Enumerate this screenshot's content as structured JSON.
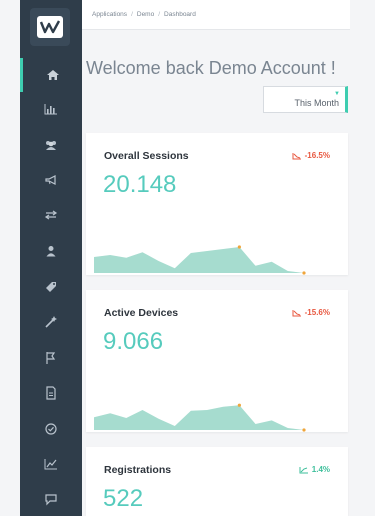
{
  "breadcrumb": [
    "Applications",
    "Demo",
    "Dashboard"
  ],
  "welcome": "Welcome back Demo Account !",
  "period_select": {
    "value": "This Month"
  },
  "sidebar": {
    "items": [
      {
        "icon": "home-icon",
        "active": true
      },
      {
        "icon": "bar-chart-icon"
      },
      {
        "icon": "users-icon"
      },
      {
        "icon": "megaphone-icon"
      },
      {
        "icon": "exchange-icon"
      },
      {
        "icon": "user-icon"
      },
      {
        "icon": "tag-icon"
      },
      {
        "icon": "magic-wand-icon"
      },
      {
        "icon": "flag-icon"
      },
      {
        "icon": "document-icon"
      },
      {
        "icon": "check-circle-icon"
      },
      {
        "icon": "line-chart-icon"
      },
      {
        "icon": "chat-icon"
      }
    ]
  },
  "cards": [
    {
      "title": "Overall Sessions",
      "value": "20.148",
      "trend": "-16.5%",
      "direction": "down",
      "spark": [
        0.4,
        0.45,
        0.38,
        0.52,
        0.3,
        0.12,
        0.5,
        0.55,
        0.6,
        0.65,
        0.18,
        0.28,
        0.05,
        0.0
      ]
    },
    {
      "title": "Active Devices",
      "value": "9.066",
      "trend": "-15.6%",
      "direction": "down",
      "spark": [
        0.32,
        0.42,
        0.3,
        0.5,
        0.28,
        0.1,
        0.48,
        0.5,
        0.58,
        0.62,
        0.15,
        0.24,
        0.05,
        0.0
      ]
    },
    {
      "title": "Registrations",
      "value": "522",
      "trend": "1.4%",
      "direction": "up",
      "spark": [
        0.3,
        0.4,
        0.35,
        0.45,
        0.3,
        0.2,
        0.45,
        0.5,
        0.55,
        0.6,
        0.2,
        0.3,
        0.1,
        0.0
      ]
    }
  ],
  "colors": {
    "accent": "#3ecdb0",
    "value": "#56cbbd",
    "down": "#e8573f",
    "up": "#3dbf9b",
    "sidebar": "#2f3d4a",
    "area": "#a6dccf"
  }
}
